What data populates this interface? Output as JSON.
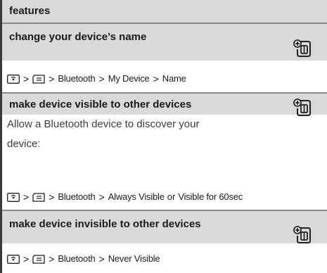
{
  "header": {
    "title": "features"
  },
  "features": [
    {
      "title": "change your device’s name",
      "description": "",
      "path": [
        "Bluetooth",
        "My Device",
        "Name"
      ],
      "alt_path_item": ""
    },
    {
      "title": "make device visible to other devices",
      "description_lines": [
        "Allow a Bluetooth device to discover your",
        "device:"
      ],
      "path": [
        "Bluetooth",
        "Always Visible"
      ],
      "path_or": "or",
      "alt_path_item": "Visible for 60sec"
    },
    {
      "title": "make device invisible to other devices",
      "description": "",
      "path": [
        "Bluetooth",
        "Never Visible"
      ],
      "alt_path_item": ""
    }
  ],
  "path_separator": ">",
  "icons": {
    "menu_key": "menu-key-icon",
    "list_key": "list-key-icon",
    "feature": "phone-plus-feature-icon"
  },
  "colors": {
    "header_bg": "#d9d9d9",
    "rule": "#8a8a8a",
    "accent_rule": "#3a3a3a"
  }
}
